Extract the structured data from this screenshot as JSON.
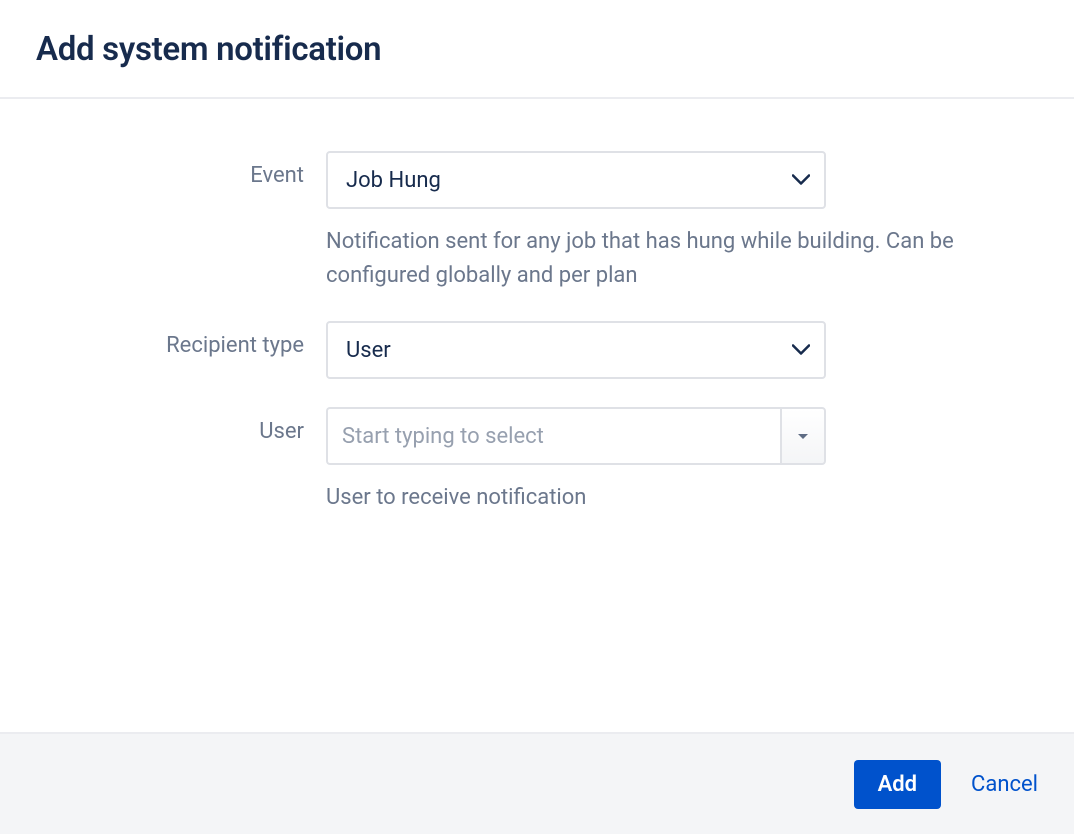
{
  "header": {
    "title": "Add system notification"
  },
  "form": {
    "event": {
      "label": "Event",
      "value": "Job Hung",
      "help": "Notification sent for any job that has hung while building. Can be configured globally and per plan"
    },
    "recipientType": {
      "label": "Recipient type",
      "value": "User"
    },
    "user": {
      "label": "User",
      "placeholder": "Start typing to select",
      "value": "",
      "help": "User to receive notification"
    }
  },
  "footer": {
    "add": "Add",
    "cancel": "Cancel"
  }
}
